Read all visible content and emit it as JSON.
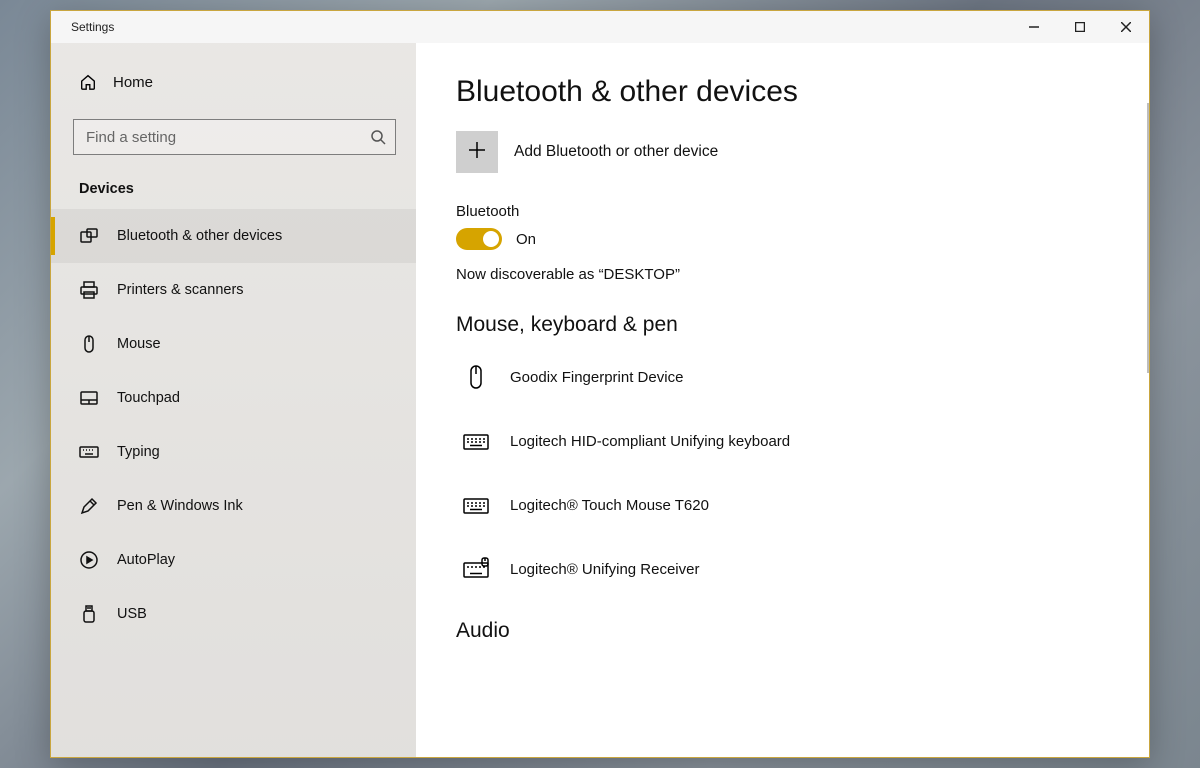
{
  "window_title": "Settings",
  "sidebar": {
    "home_label": "Home",
    "search_placeholder": "Find a setting",
    "section_label": "Devices",
    "items": [
      {
        "id": "bluetooth",
        "label": "Bluetooth & other devices",
        "icon": "devices",
        "active": true
      },
      {
        "id": "printers",
        "label": "Printers & scanners",
        "icon": "printer",
        "active": false
      },
      {
        "id": "mouse",
        "label": "Mouse",
        "icon": "mouse",
        "active": false
      },
      {
        "id": "touchpad",
        "label": "Touchpad",
        "icon": "touchpad",
        "active": false
      },
      {
        "id": "typing",
        "label": "Typing",
        "icon": "keyboard",
        "active": false
      },
      {
        "id": "pen",
        "label": "Pen & Windows Ink",
        "icon": "pen",
        "active": false
      },
      {
        "id": "autoplay",
        "label": "AutoPlay",
        "icon": "autoplay",
        "active": false
      },
      {
        "id": "usb",
        "label": "USB",
        "icon": "usb",
        "active": false
      }
    ]
  },
  "main": {
    "title": "Bluetooth & other devices",
    "add_label": "Add Bluetooth or other device",
    "bluetooth_label": "Bluetooth",
    "toggle_state": "On",
    "discoverable_text": "Now discoverable as “DESKTOP”",
    "group1_title": "Mouse, keyboard & pen",
    "devices": [
      {
        "name": "Goodix Fingerprint Device",
        "icon": "mouse"
      },
      {
        "name": "Logitech HID-compliant Unifying keyboard",
        "icon": "keyboard"
      },
      {
        "name": "Logitech® Touch Mouse T620",
        "icon": "keyboard"
      },
      {
        "name": "Logitech® Unifying Receiver",
        "icon": "keyboard-usb"
      }
    ],
    "group2_title": "Audio"
  },
  "colors": {
    "accent": "#d6a400"
  }
}
